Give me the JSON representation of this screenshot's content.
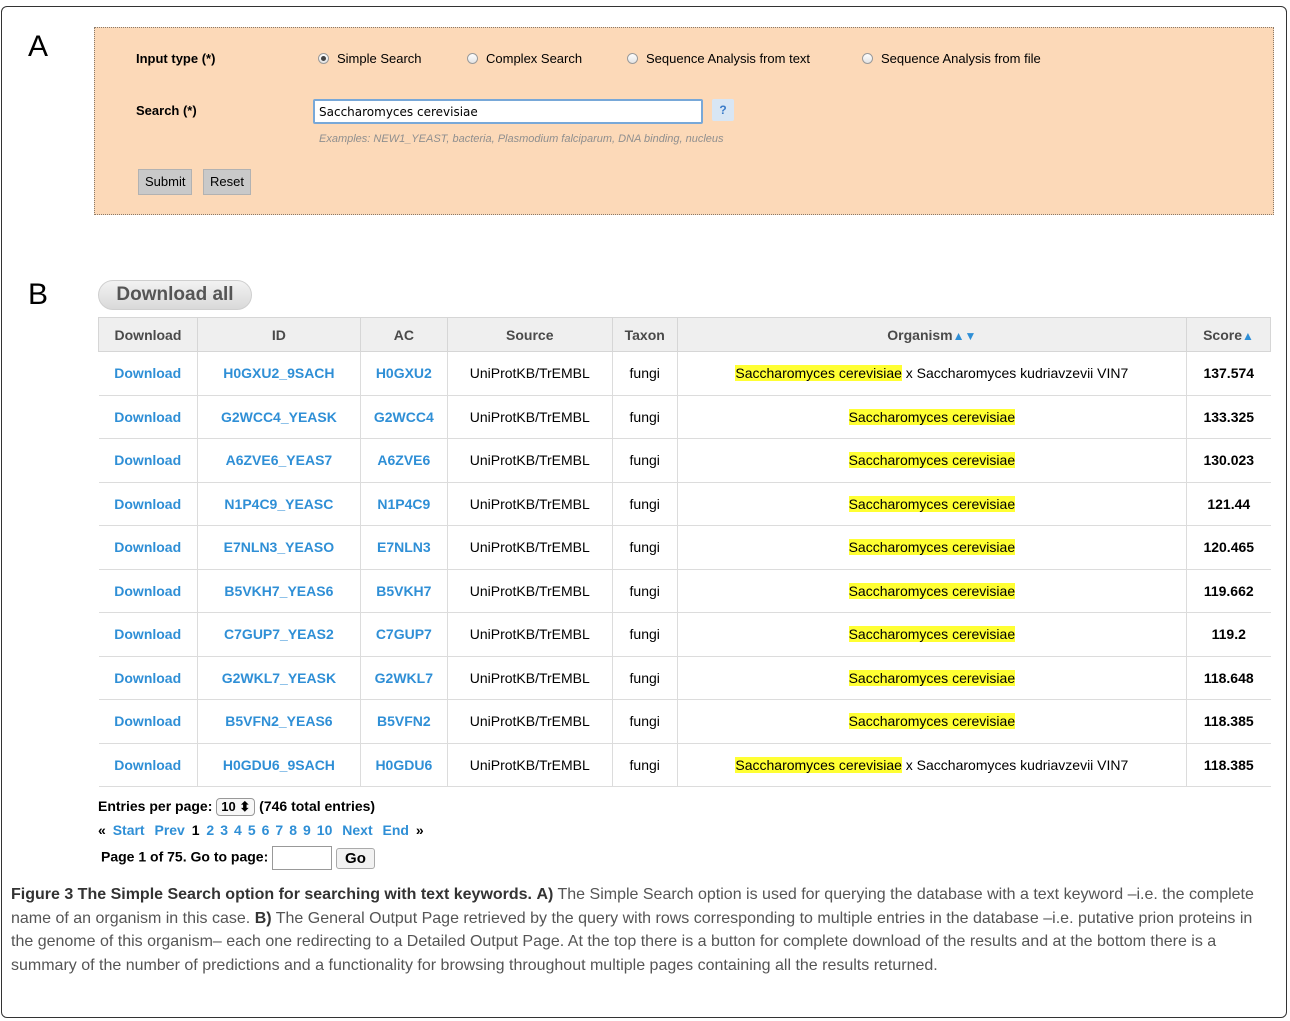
{
  "panel_a": {
    "letter": "A",
    "input_type_label": "Input type (*)",
    "radios": [
      {
        "label": "Simple Search",
        "checked": true
      },
      {
        "label": "Complex Search",
        "checked": false
      },
      {
        "label": "Sequence Analysis from text",
        "checked": false
      },
      {
        "label": "Sequence Analysis from file",
        "checked": false
      }
    ],
    "search_label": "Search (*)",
    "search_value": "Saccharomyces cerevisiae",
    "help_label": "?",
    "examples": "Examples: NEW1_YEAST, bacteria, Plasmodium falciparum, DNA binding, nucleus",
    "submit_label": "Submit",
    "reset_label": "Reset"
  },
  "panel_b": {
    "letter": "B",
    "download_all_label": "Download all",
    "columns": [
      "Download",
      "ID",
      "AC",
      "Source",
      "Taxon",
      "Organism",
      "Score"
    ],
    "sort_arrows": {
      "organism": "▲▼",
      "score": "▲"
    },
    "rows": [
      {
        "download": "Download",
        "id": "H0GXU2_9SACH",
        "ac": "H0GXU2",
        "source": "UniProtKB/TrEMBL",
        "taxon": "fungi",
        "organism_hl": "Saccharomyces cerevisiae",
        "organism_rest": " x Saccharomyces kudriavzevii VIN7",
        "score": "137.574"
      },
      {
        "download": "Download",
        "id": "G2WCC4_YEASK",
        "ac": "G2WCC4",
        "source": "UniProtKB/TrEMBL",
        "taxon": "fungi",
        "organism_hl": "Saccharomyces cerevisiae",
        "organism_rest": "",
        "score": "133.325"
      },
      {
        "download": "Download",
        "id": "A6ZVE6_YEAS7",
        "ac": "A6ZVE6",
        "source": "UniProtKB/TrEMBL",
        "taxon": "fungi",
        "organism_hl": "Saccharomyces cerevisiae",
        "organism_rest": "",
        "score": "130.023"
      },
      {
        "download": "Download",
        "id": "N1P4C9_YEASC",
        "ac": "N1P4C9",
        "source": "UniProtKB/TrEMBL",
        "taxon": "fungi",
        "organism_hl": "Saccharomyces cerevisiae",
        "organism_rest": "",
        "score": "121.44"
      },
      {
        "download": "Download",
        "id": "E7NLN3_YEASO",
        "ac": "E7NLN3",
        "source": "UniProtKB/TrEMBL",
        "taxon": "fungi",
        "organism_hl": "Saccharomyces cerevisiae",
        "organism_rest": "",
        "score": "120.465"
      },
      {
        "download": "Download",
        "id": "B5VKH7_YEAS6",
        "ac": "B5VKH7",
        "source": "UniProtKB/TrEMBL",
        "taxon": "fungi",
        "organism_hl": "Saccharomyces cerevisiae",
        "organism_rest": "",
        "score": "119.662"
      },
      {
        "download": "Download",
        "id": "C7GUP7_YEAS2",
        "ac": "C7GUP7",
        "source": "UniProtKB/TrEMBL",
        "taxon": "fungi",
        "organism_hl": "Saccharomyces cerevisiae",
        "organism_rest": "",
        "score": "119.2"
      },
      {
        "download": "Download",
        "id": "G2WKL7_YEASK",
        "ac": "G2WKL7",
        "source": "UniProtKB/TrEMBL",
        "taxon": "fungi",
        "organism_hl": "Saccharomyces cerevisiae",
        "organism_rest": "",
        "score": "118.648"
      },
      {
        "download": "Download",
        "id": "B5VFN2_YEAS6",
        "ac": "B5VFN2",
        "source": "UniProtKB/TrEMBL",
        "taxon": "fungi",
        "organism_hl": "Saccharomyces cerevisiae",
        "organism_rest": "",
        "score": "118.385"
      },
      {
        "download": "Download",
        "id": "H0GDU6_9SACH",
        "ac": "H0GDU6",
        "source": "UniProtKB/TrEMBL",
        "taxon": "fungi",
        "organism_hl": "Saccharomyces cerevisiae",
        "organism_rest": " x Saccharomyces kudriavzevii VIN7",
        "score": "118.385"
      }
    ],
    "pager": {
      "entries_label": "Entries per page:",
      "entries_value": "10",
      "select_arrows": "⬍",
      "total": "(746 total entries)",
      "first_marker": "«",
      "start": "Start",
      "prev": "Prev",
      "current": "1",
      "pages": [
        "2",
        "3",
        "4",
        "5",
        "6",
        "7",
        "8",
        "9",
        "10"
      ],
      "next": "Next",
      "end": "End",
      "last_marker": "»",
      "page_of": "Page 1 of 75.",
      "goto_label": "Go to page:",
      "go_label": "Go"
    }
  },
  "caption": {
    "title": "Figure 3 The Simple Search option for searching with text keywords.",
    "a_label": "A)",
    "a_text": "The Simple Search option is used for querying the database with a text keyword –i.e. the complete name of an organism in this case.",
    "b_label": "B)",
    "b_text": "The General Output Page retrieved by the query with rows corresponding to multiple entries in the database –i.e. putative prion proteins in the genome of this organism– each one redirecting to a Detailed Output Page. At the top there is a button for complete download of the results and at the bottom there is a summary of the number of predictions and a functionality for browsing throughout multiple pages containing all the results returned."
  }
}
